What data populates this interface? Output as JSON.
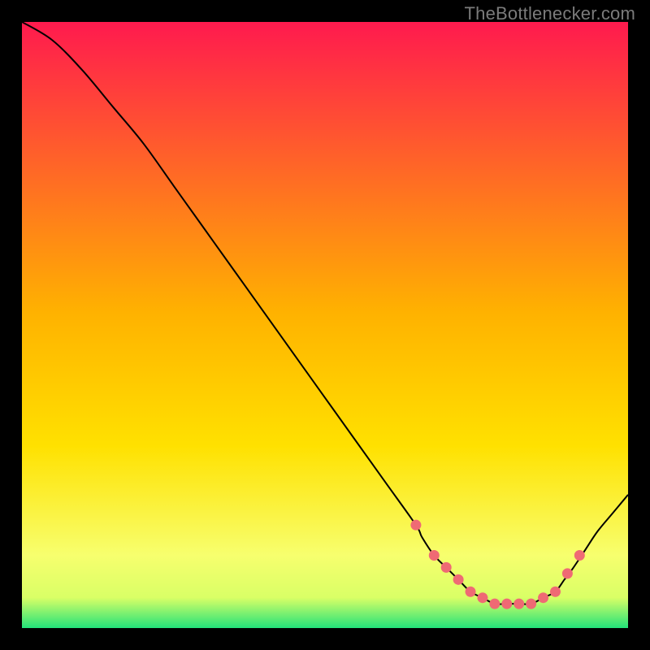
{
  "attribution": "TheBottlenecker.com",
  "colors": {
    "gradient_top": "#ff1a4e",
    "gradient_mid": "#ffd600",
    "gradient_low": "#faff7a",
    "gradient_bottom": "#23e27a",
    "curve_stroke": "#000000",
    "marker_fill": "#ef6a74",
    "marker_stroke": "#ef6a74",
    "frame": "#000000"
  },
  "chart_data": {
    "type": "line",
    "title": "",
    "xlabel": "",
    "ylabel": "",
    "xlim": [
      0,
      100
    ],
    "ylim": [
      0,
      100
    ],
    "x": [
      0,
      5,
      10,
      15,
      20,
      25,
      30,
      35,
      40,
      45,
      50,
      55,
      60,
      65,
      66,
      68,
      70,
      72,
      74,
      76,
      78,
      80,
      82,
      84,
      86,
      88,
      89.5,
      91,
      93,
      95,
      97.5,
      100
    ],
    "values": [
      100,
      97,
      92,
      86,
      80,
      73,
      66,
      59,
      52,
      45,
      38,
      31,
      24,
      17,
      15,
      12,
      10,
      8,
      6,
      5,
      4,
      4,
      4,
      4,
      5,
      6,
      8,
      10,
      13,
      16,
      19,
      22
    ],
    "markers_x": [
      65,
      68,
      70,
      72,
      74,
      76,
      78,
      80,
      82,
      84,
      86,
      88,
      90,
      92
    ],
    "markers_y": [
      17,
      12,
      10,
      8,
      6,
      5,
      4,
      4,
      4,
      4,
      5,
      6,
      9,
      12
    ]
  }
}
